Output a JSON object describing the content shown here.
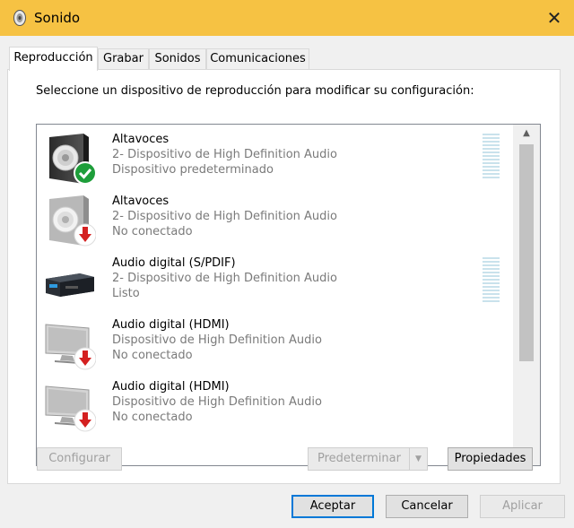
{
  "window": {
    "title": "Sonido",
    "close_glyph": "✕"
  },
  "tabs": [
    {
      "label": "Reproducción",
      "active": true
    },
    {
      "label": "Grabar",
      "active": false
    },
    {
      "label": "Sonidos",
      "active": false
    },
    {
      "label": "Comunicaciones",
      "active": false
    }
  ],
  "panel": {
    "instruction": "Seleccione un dispositivo de reproducción para modificar su configuración:"
  },
  "devices": [
    {
      "name": "Altavoces",
      "description": "2- Dispositivo de High Definition Audio",
      "status": "Dispositivo predeterminado",
      "icon": "speaker-icon",
      "badge": "default-check-icon",
      "level_meter": true
    },
    {
      "name": "Altavoces",
      "description": "2- Dispositivo de High Definition Audio",
      "status": "No conectado",
      "icon": "speaker-icon",
      "badge": "disconnected-arrow-icon",
      "level_meter": false
    },
    {
      "name": "Audio digital (S/PDIF)",
      "description": "2- Dispositivo de High Definition Audio",
      "status": "Listo",
      "icon": "digital-receiver-icon",
      "badge": "",
      "level_meter": true
    },
    {
      "name": "Audio digital (HDMI)",
      "description": "Dispositivo de High Definition Audio",
      "status": "No conectado",
      "icon": "monitor-icon",
      "badge": "disconnected-arrow-icon",
      "level_meter": false
    },
    {
      "name": "Audio digital (HDMI)",
      "description": "Dispositivo de High Definition Audio",
      "status": "No conectado",
      "icon": "monitor-icon",
      "badge": "disconnected-arrow-icon",
      "level_meter": false
    }
  ],
  "scroll": {
    "up_glyph": "▲",
    "down_glyph": "▼"
  },
  "panel_buttons": {
    "configure": "Configurar",
    "set_default": "Predeterminar",
    "set_default_arrow": "▼",
    "properties": "Propiedades"
  },
  "dialog_buttons": {
    "ok": "Aceptar",
    "cancel": "Cancelar",
    "apply": "Aplicar"
  },
  "colors": {
    "titlebar": "#f6c243",
    "default_check": "#1e9e3a",
    "disconnected_arrow": "#d42020",
    "level_meter": "#c9e2ec",
    "focus_border": "#0078d7"
  }
}
